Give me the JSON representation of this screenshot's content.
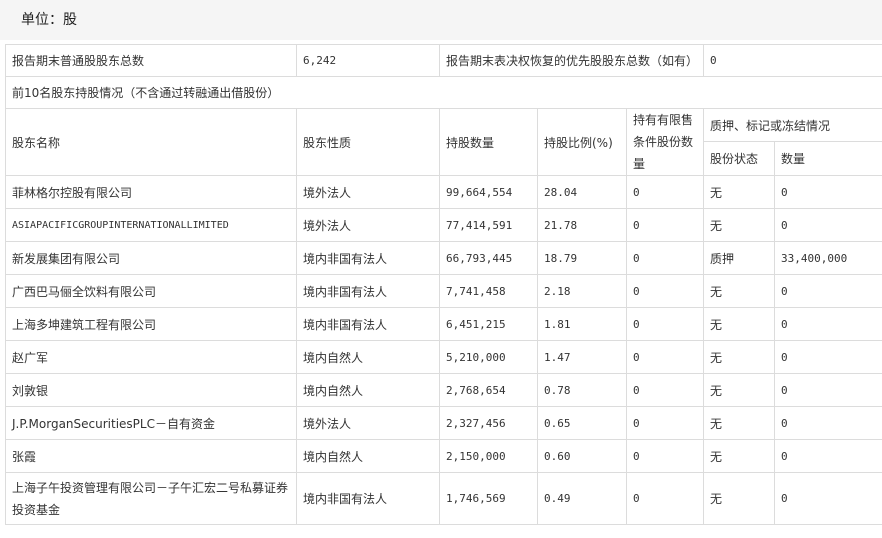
{
  "unit_label": "单位：股",
  "summary": {
    "common_label": "报告期末普通股股东总数",
    "common_value": "6,242",
    "preferred_label": "报告期末表决权恢复的优先股股东总数（如有）",
    "preferred_value": "0"
  },
  "section_title": "前10名股东持股情况（不含通过转融通出借股份）",
  "headers": {
    "name": "股东名称",
    "nature": "股东性质",
    "shares": "持股数量",
    "ratio": "持股比例(%)",
    "restricted": "持有有限售条件股份数量",
    "pledge_group": "质押、标记或冻结情况",
    "pledge_status": "股份状态",
    "pledge_qty": "数量"
  },
  "rows": [
    {
      "name": "菲林格尔控股有限公司",
      "nature": "境外法人",
      "shares": "99,664,554",
      "ratio": "28.04",
      "restricted": "0",
      "status": "无",
      "qty": "0"
    },
    {
      "name": "ASIAPACIFICGROUPINTERNATIONALLIMITED",
      "nature": "境外法人",
      "shares": "77,414,591",
      "ratio": "21.78",
      "restricted": "0",
      "status": "无",
      "qty": "0"
    },
    {
      "name": "新发展集团有限公司",
      "nature": "境内非国有法人",
      "shares": "66,793,445",
      "ratio": "18.79",
      "restricted": "0",
      "status": "质押",
      "qty": "33,400,000"
    },
    {
      "name": "广西巴马俪全饮料有限公司",
      "nature": "境内非国有法人",
      "shares": "7,741,458",
      "ratio": "2.18",
      "restricted": "0",
      "status": "无",
      "qty": "0"
    },
    {
      "name": "上海多坤建筑工程有限公司",
      "nature": "境内非国有法人",
      "shares": "6,451,215",
      "ratio": "1.81",
      "restricted": "0",
      "status": "无",
      "qty": "0"
    },
    {
      "name": "赵广军",
      "nature": "境内自然人",
      "shares": "5,210,000",
      "ratio": "1.47",
      "restricted": "0",
      "status": "无",
      "qty": "0"
    },
    {
      "name": "刘敦银",
      "nature": "境内自然人",
      "shares": "2,768,654",
      "ratio": "0.78",
      "restricted": "0",
      "status": "无",
      "qty": "0"
    },
    {
      "name": "J.P.MorganSecuritiesPLC－自有资金",
      "nature": "境外法人",
      "shares": "2,327,456",
      "ratio": "0.65",
      "restricted": "0",
      "status": "无",
      "qty": "0"
    },
    {
      "name": "张霞",
      "nature": "境内自然人",
      "shares": "2,150,000",
      "ratio": "0.60",
      "restricted": "0",
      "status": "无",
      "qty": "0"
    },
    {
      "name": "上海子午投资管理有限公司－子午汇宏二号私募证券投资基金",
      "nature": "境内非国有法人",
      "shares": "1,746,569",
      "ratio": "0.49",
      "restricted": "0",
      "status": "无",
      "qty": "0"
    }
  ]
}
